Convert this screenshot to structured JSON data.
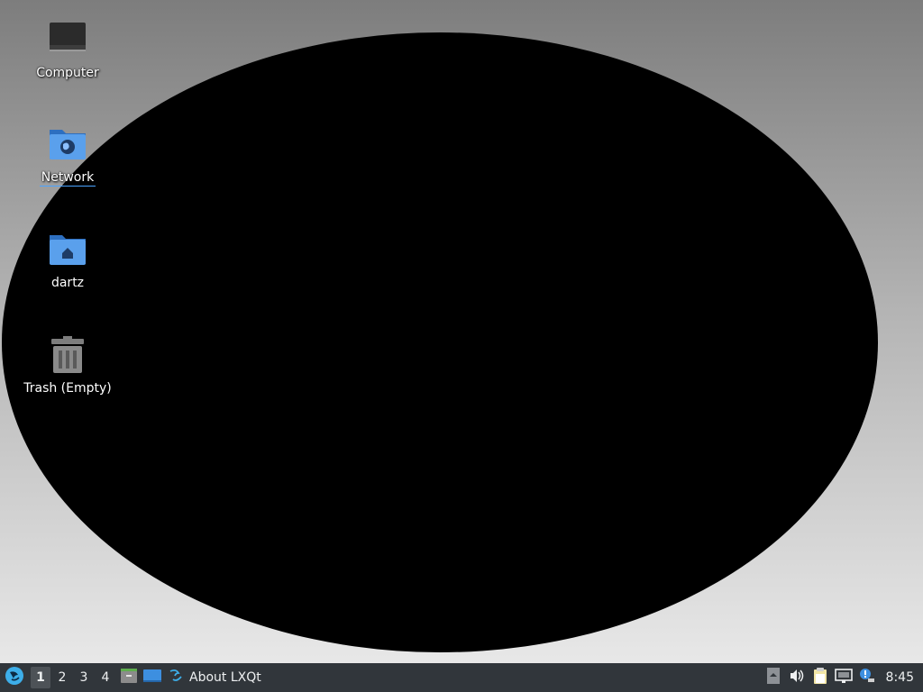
{
  "desktop": {
    "icons": [
      {
        "label": "Computer",
        "icon": "computer-icon"
      },
      {
        "label": "Network",
        "icon": "network-folder-icon"
      },
      {
        "label": "dartz",
        "icon": "home-folder-icon"
      },
      {
        "label": "Trash (Empty)",
        "icon": "trash-icon"
      }
    ]
  },
  "taskbar": {
    "start_icon": "lxqt-menu-icon",
    "desktops": [
      "1",
      "2",
      "3",
      "4"
    ],
    "active_desktop": "1",
    "quick_launch": [
      {
        "icon": "file-manager-icon"
      },
      {
        "icon": "show-desktop-icon"
      }
    ],
    "task": {
      "label": "About LXQt",
      "icon": "lxqt-logo-icon"
    },
    "tray": [
      {
        "icon": "tray-expand-icon"
      },
      {
        "icon": "volume-icon"
      },
      {
        "icon": "clipboard-icon"
      },
      {
        "icon": "network-wired-icon"
      },
      {
        "icon": "update-notifier-icon"
      }
    ],
    "clock": "8:45"
  },
  "colors": {
    "taskbar_bg": "#31363b",
    "folder_blue": "#4a90d9",
    "accent": "#3daee9"
  }
}
